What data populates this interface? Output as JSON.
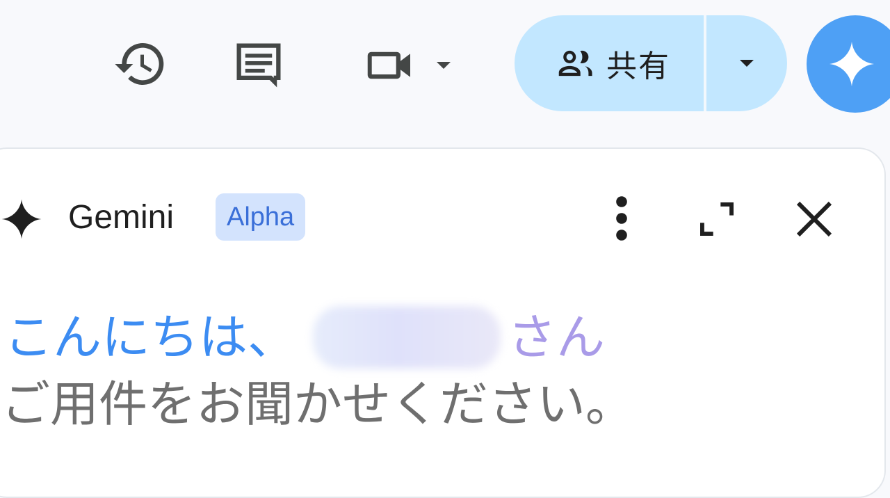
{
  "toolbar": {
    "history_icon": "history-icon",
    "comments_icon": "comments-icon",
    "meet_icon": "video-camera-icon",
    "share_label": "共有",
    "share_icon": "people-icon",
    "gemini_icon": "gemini-spark-icon"
  },
  "panel": {
    "title": "Gemini",
    "badge": "Alpha",
    "more_icon": "more-vert-icon",
    "expand_icon": "expand-icon",
    "close_icon": "close-icon",
    "greeting_hello": "こんにちは、",
    "greeting_suffix": "さん",
    "prompt": "ご用件をお聞かせください。"
  },
  "colors": {
    "share_bg": "#c2e7ff",
    "fab_bg": "#4ea0f5",
    "greeting_blue": "#3c8cf2",
    "greeting_purple": "#a99be8",
    "badge_bg": "#d3e3fd",
    "badge_text": "#3a6fd8"
  }
}
